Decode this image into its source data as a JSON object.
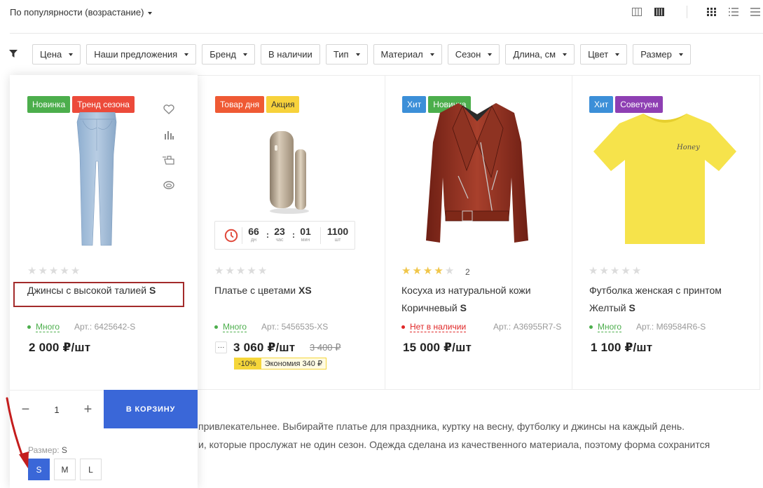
{
  "sort": {
    "label": "По популярности (возрастание)"
  },
  "filters": [
    "Цена",
    "Наши предложения",
    "Бренд",
    "В наличии",
    "Тип",
    "Материал",
    "Сезон",
    "Длина, см",
    "Цвет",
    "Размер"
  ],
  "filters_caret": [
    true,
    true,
    true,
    false,
    true,
    true,
    true,
    true,
    true,
    true
  ],
  "colors": {
    "green": "#4cae4c",
    "red": "#ec4a3a",
    "orange_red": "#ef5a34",
    "yellow": "#f7d23b",
    "blue": "#3c8fd8",
    "purple": "#8e3fb3",
    "accent": "#3a67d8"
  },
  "products": [
    {
      "badges": [
        "Новинка",
        "Тренд сезона"
      ],
      "name": "Джинсы с высокой талией",
      "size_tag": "S",
      "stock": "Много",
      "art": "Арт.: 6425642-S",
      "price": "2 000 ₽/шт",
      "rating": 0
    },
    {
      "badges": [
        "Товар дня",
        "Акция"
      ],
      "name": "Платье с цветами",
      "size_tag": "XS",
      "stock": "Много",
      "art": "Арт.: 5456535-XS",
      "price": "3 060 ₽/шт",
      "old_price": "3 400 ₽",
      "discount": "-10%",
      "saving": "Экономия 340 ₽",
      "more": "···",
      "rating": 0,
      "timer": {
        "days": "66",
        "days_lbl": "дн",
        "hours": "23",
        "hours_lbl": "час",
        "mins": "01",
        "mins_lbl": "мин",
        "qty": "1100",
        "qty_lbl": "шт",
        "sep": ":"
      }
    },
    {
      "badges": [
        "Хит",
        "Новинка"
      ],
      "name_line1": "Косуха из натуральной кожи",
      "name_line2": "Коричневый",
      "size_tag": "S",
      "stock": "Нет в наличии",
      "art": "Арт.: A36955R7-S",
      "price": "15 000 ₽/шт",
      "rating": 4,
      "rating_count": "2"
    },
    {
      "badges": [
        "Хит",
        "Советуем"
      ],
      "name_line1": "Футболка женская с принтом",
      "name_line2": "Желтый",
      "size_tag": "S",
      "stock": "Много",
      "art": "Арт.: M69584R6-S",
      "price": "1 100 ₽/шт",
      "rating": 0,
      "print_text": "Honey"
    }
  ],
  "cart": {
    "qty": "1",
    "minus": "−",
    "plus": "+",
    "button": "В КОРЗИНУ"
  },
  "size": {
    "label": "Размер:",
    "value": "S",
    "options": [
      "S",
      "M",
      "L"
    ],
    "selected": "S"
  },
  "description": {
    "line1": "привлекательнее. Выбирайте платье для праздника, куртку на весну, футболку и джинсы на каждый день.",
    "line2": "и, которые прослужат не один сезон. Одежда сделана из качественного материала, поэтому форма сохранится"
  }
}
